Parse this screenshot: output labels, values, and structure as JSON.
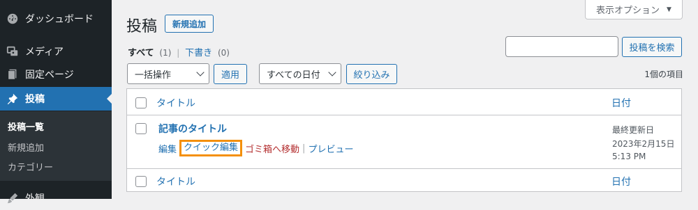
{
  "sidebar": {
    "items": [
      {
        "label": "ダッシュボード",
        "icon": "dashboard-icon"
      },
      {
        "label": "メディア",
        "icon": "media-icon"
      },
      {
        "label": "固定ページ",
        "icon": "page-icon"
      },
      {
        "label": "投稿",
        "icon": "pin-icon"
      },
      {
        "label": "外観",
        "icon": "appearance-icon"
      }
    ],
    "submenu": [
      "投稿一覧",
      "新規追加",
      "カテゴリー"
    ]
  },
  "header": {
    "title": "投稿",
    "add_new": "新規追加",
    "screen_options": "表示オプション"
  },
  "filters": {
    "all_label": "すべて",
    "all_count": "(1)",
    "separator": "|",
    "draft_label": "下書き",
    "draft_count": "(0)"
  },
  "search": {
    "value": "",
    "button": "投稿を検索"
  },
  "toolbar": {
    "bulk_action": "一括操作",
    "apply": "適用",
    "date_filter": "すべての日付",
    "filter_button": "絞り込み",
    "item_count": "1個の項目"
  },
  "table": {
    "col_title": "タイトル",
    "col_date": "日付",
    "rows": [
      {
        "title": "記事のタイトル",
        "actions": {
          "edit": "編集",
          "quick_edit": "クイック編集",
          "trash": "ゴミ箱へ移動",
          "sep": "|",
          "preview": "プレビュー"
        },
        "date_status": "最終更新日",
        "date": "2023年2月15日",
        "time": "5:13 PM"
      }
    ]
  },
  "colors": {
    "accent": "#2271b1",
    "highlight": "#f4900c",
    "danger": "#b32d2e",
    "sidebar": "#1d2327"
  }
}
